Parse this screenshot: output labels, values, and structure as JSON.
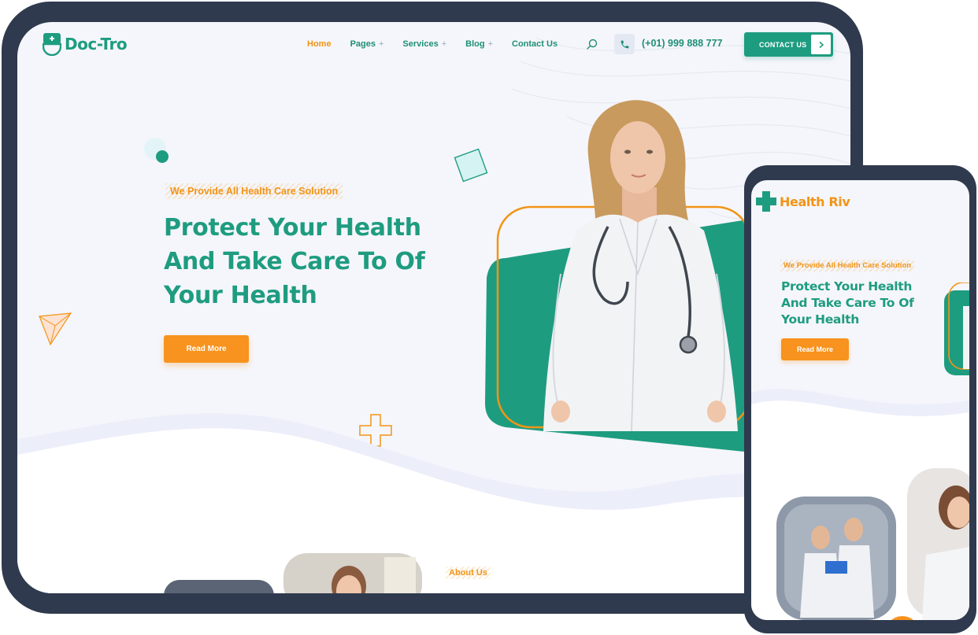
{
  "colors": {
    "primary": "#1e9c80",
    "accent": "#f7931e",
    "frame": "#2f3a4e",
    "background": "#f5f6fb"
  },
  "tablet": {
    "brand": "Doc-Tro",
    "nav": [
      {
        "label": "Home",
        "active": true
      },
      {
        "label": "Pages",
        "has_submenu": true
      },
      {
        "label": "Services",
        "has_submenu": true
      },
      {
        "label": "Blog",
        "has_submenu": true
      },
      {
        "label": "Contact Us"
      }
    ],
    "submenu_symbol": "+",
    "phone": "(+01) 999 888 777",
    "contact_button": "CONTACT US",
    "tagline": "We Provide All Health Care Solution",
    "hero_title": "Protect Your Health And Take Care To Of Your Health",
    "read_more": "Read More",
    "about_label": "About Us",
    "icons": [
      "logo-mark-icon",
      "search-icon",
      "phone-icon",
      "chevron-right-icon"
    ]
  },
  "phone_mockup": {
    "brand": "Health Riv",
    "tagline": "We Provide All Health Care Solution",
    "hero_title": "Protect Your Health And Take Care To Of Your Health",
    "read_more": "Read More",
    "icons": [
      "medical-cross-logo-icon"
    ]
  }
}
